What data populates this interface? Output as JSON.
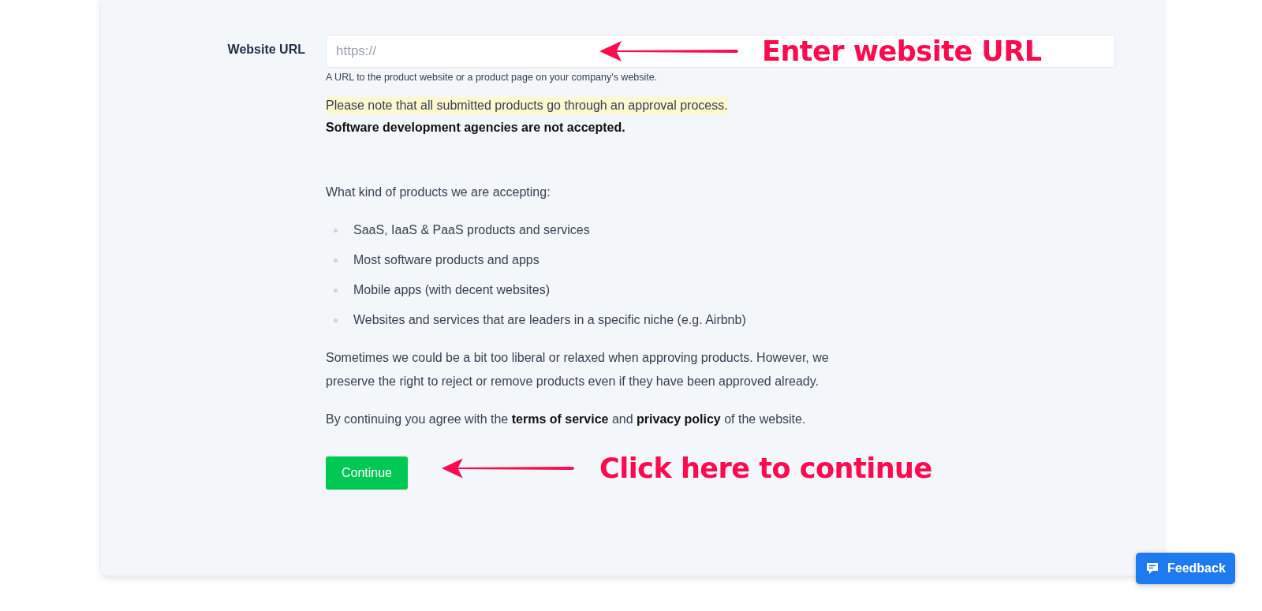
{
  "form": {
    "field": {
      "label": "Website URL",
      "placeholder": "https://",
      "help": "A URL to the product website or a product page on your company's website."
    },
    "notice": "Please note that all submitted products go through an approval process.",
    "warning": "Software development agencies are not accepted.",
    "intro": "What kind of products we are accepting:",
    "accepted": [
      "SaaS, IaaS & PaaS products and services",
      "Most software products and apps",
      "Mobile apps (with decent websites)",
      "Websites and services that are leaders in a specific niche (e.g. Airbnb)"
    ],
    "disclaimer": "Sometimes we could be a bit too liberal or relaxed when approving products. However, we preserve the right to reject or remove products even if they have been approved already.",
    "agreement": [
      "By continuing you agree with the ",
      "terms of service",
      " and ",
      "privacy policy",
      " of the website."
    ],
    "button": "Continue"
  },
  "annotations": [
    {
      "kind": "field",
      "text": "Enter website URL"
    },
    {
      "kind": "button",
      "text": "Click here to continue"
    }
  ],
  "feedback": {
    "label": "Feedback"
  }
}
